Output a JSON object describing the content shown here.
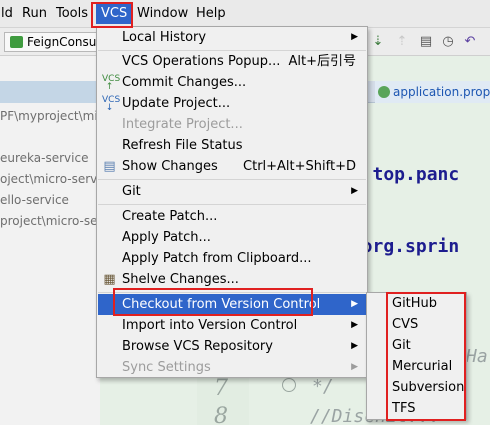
{
  "menubar": {
    "items": [
      {
        "label": "ld",
        "mnemonic": ""
      },
      {
        "label": "Run",
        "mnemonic": "R"
      },
      {
        "label": "Tools",
        "mnemonic": "T"
      },
      {
        "label": "VCS",
        "mnemonic": "S",
        "active": true
      },
      {
        "label": "Window",
        "mnemonic": "W"
      },
      {
        "label": "Help",
        "mnemonic": "H"
      }
    ]
  },
  "toolbar": {
    "run_config": "FeignConsumer"
  },
  "project_panel": {
    "lines": [
      "PF\\myproject\\micro",
      "eureka-service",
      "oject\\micro-servic",
      "ello-service",
      "project\\micro-se"
    ]
  },
  "editor": {
    "tab_label": "application.properties",
    "code_lines": [
      {
        "text": "ge top.panc"
      },
      {
        "text": "t org.sprin"
      },
      {
        "text": "Ha"
      },
      {
        "text": "*/"
      },
      {
        "text": "//Dischit..."
      }
    ],
    "line_numbers": [
      "7",
      "8"
    ]
  },
  "vcs_menu": {
    "items": [
      {
        "label": "Local History",
        "submenu": true,
        "enabled": true
      },
      {
        "label": "VCS Operations Popup...",
        "shortcut": "Alt+后引号",
        "enabled": true
      },
      {
        "label": "Commit Changes...",
        "icon": "vcs-commit-icon",
        "enabled": true
      },
      {
        "label": "Update Project...",
        "icon": "vcs-update-icon",
        "enabled": true
      },
      {
        "label": "Integrate Project...",
        "enabled": false
      },
      {
        "label": "Refresh File Status",
        "enabled": true
      },
      {
        "label": "Show Changes",
        "shortcut": "Ctrl+Alt+Shift+D",
        "icon": "changes-icon",
        "enabled": true
      },
      {
        "label": "Git",
        "submenu": true,
        "enabled": true
      },
      {
        "label": "Create Patch...",
        "enabled": true
      },
      {
        "label": "Apply Patch...",
        "enabled": true
      },
      {
        "label": "Apply Patch from Clipboard...",
        "enabled": true
      },
      {
        "label": "Shelve Changes...",
        "icon": "shelve-icon",
        "enabled": true
      },
      {
        "label": "Checkout from Version Control",
        "submenu": true,
        "enabled": true,
        "selected": true
      },
      {
        "label": "Import into Version Control",
        "submenu": true,
        "enabled": true
      },
      {
        "label": "Browse VCS Repository",
        "submenu": true,
        "enabled": true
      },
      {
        "label": "Sync Settings",
        "submenu": true,
        "enabled": false
      }
    ]
  },
  "checkout_submenu": {
    "items": [
      "GitHub",
      "CVS",
      "Git",
      "Mercurial",
      "Subversion",
      "TFS"
    ]
  },
  "colors": {
    "selection": "#2f65ca",
    "highlight_box": "#e02020",
    "menu_bg": "#f0f0f0"
  }
}
